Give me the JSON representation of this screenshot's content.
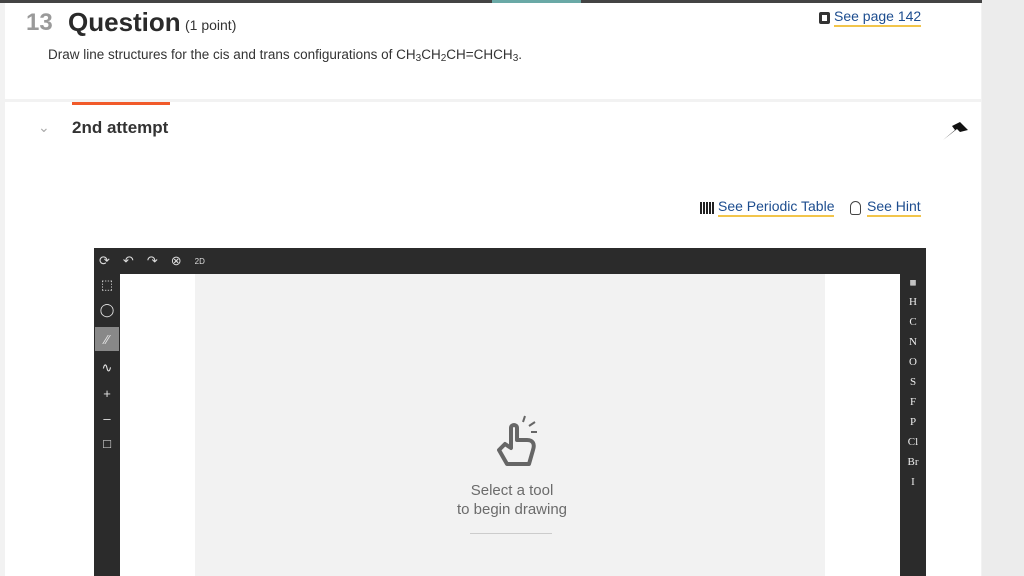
{
  "question": {
    "number": "13",
    "title": "Question",
    "points": "(1 point)",
    "text": "Draw line structures for the cis and trans configurations of CH",
    "formula_parts": [
      "3",
      "CH",
      "2",
      "CH=CHCH",
      "3",
      "."
    ],
    "see_page": "See page 142"
  },
  "attempt": {
    "label": "2nd attempt"
  },
  "links": {
    "periodic_table": "See Periodic Table",
    "hint": "See Hint"
  },
  "editor": {
    "top_tools": [
      "refresh-icon",
      "undo-icon",
      "redo-icon",
      "zoom-icon",
      "2d-icon"
    ],
    "top_2d_label": "2D",
    "elements": [
      "H",
      "C",
      "N",
      "O",
      "S",
      "F",
      "P",
      "Cl",
      "Br",
      "I"
    ],
    "prompt_line1": "Select a tool",
    "prompt_line2": "to begin drawing"
  },
  "colors": {
    "link": "#1d4d8f",
    "underline": "#f2c54b",
    "attempt_accent": "#f15a2a",
    "editor_bg": "#2b2b2b"
  }
}
